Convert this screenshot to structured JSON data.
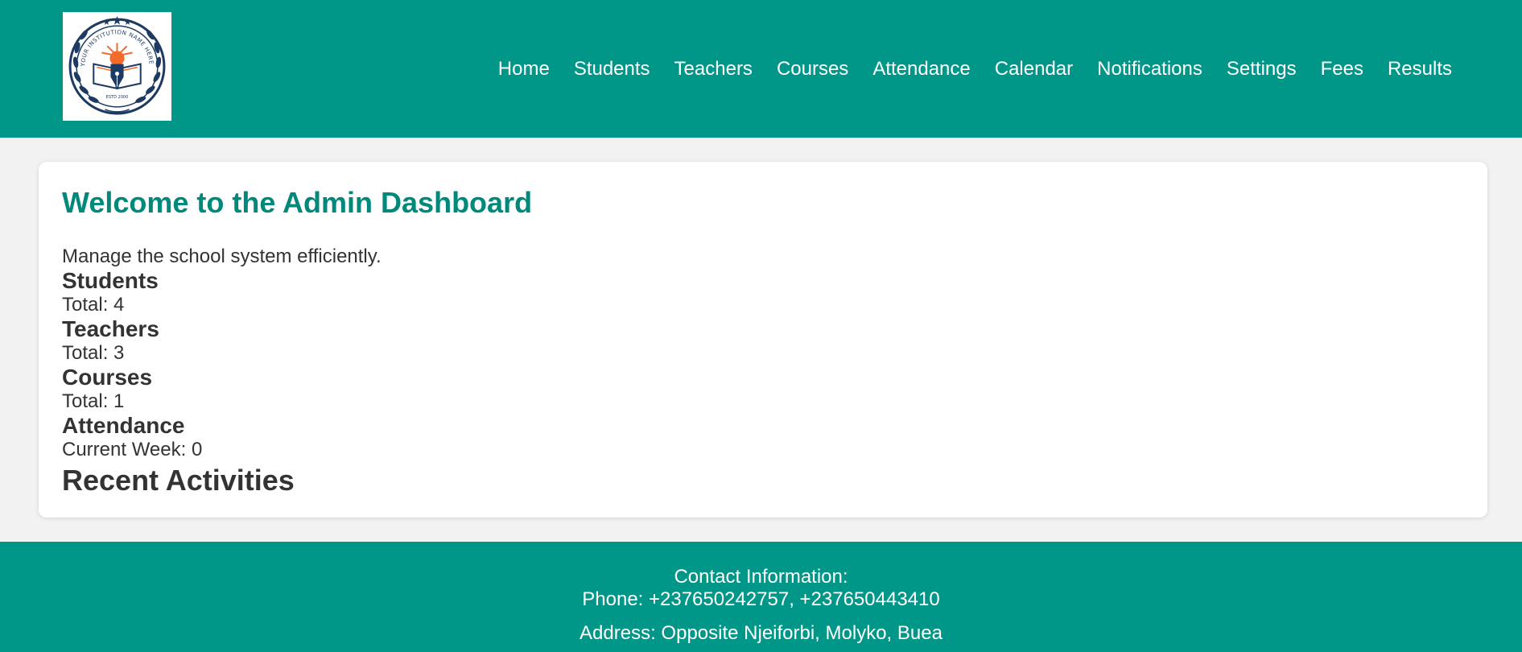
{
  "header": {
    "logo": {
      "alt": "Institution logo",
      "ring_text": "YOUR INSTITUTION NAME HERE",
      "bottom_text": "ESTD 2000",
      "colors": {
        "navy": "#1d3a63",
        "orange": "#f26b2a"
      }
    },
    "nav": [
      {
        "label": "Home"
      },
      {
        "label": "Students"
      },
      {
        "label": "Teachers"
      },
      {
        "label": "Courses"
      },
      {
        "label": "Attendance"
      },
      {
        "label": "Calendar"
      },
      {
        "label": "Notifications"
      },
      {
        "label": "Settings"
      },
      {
        "label": "Fees"
      },
      {
        "label": "Results"
      }
    ]
  },
  "main": {
    "title": "Welcome to the Admin Dashboard",
    "intro": "Manage the school system efficiently.",
    "stats": [
      {
        "title": "Students",
        "value": "Total: 4"
      },
      {
        "title": "Teachers",
        "value": "Total: 3"
      },
      {
        "title": "Courses",
        "value": "Total: 1"
      },
      {
        "title": "Attendance",
        "value": "Current Week: 0"
      }
    ],
    "recent_title": "Recent Activities"
  },
  "footer": {
    "contact_label": "Contact Information:",
    "phone": "Phone: +237650242757, +237650443410",
    "address": "Address: Opposite Njeiforbi, Molyko, Buea"
  },
  "colors": {
    "primary": "#009688",
    "title": "#00897b",
    "background": "#f2f2f2",
    "text": "#333333"
  }
}
